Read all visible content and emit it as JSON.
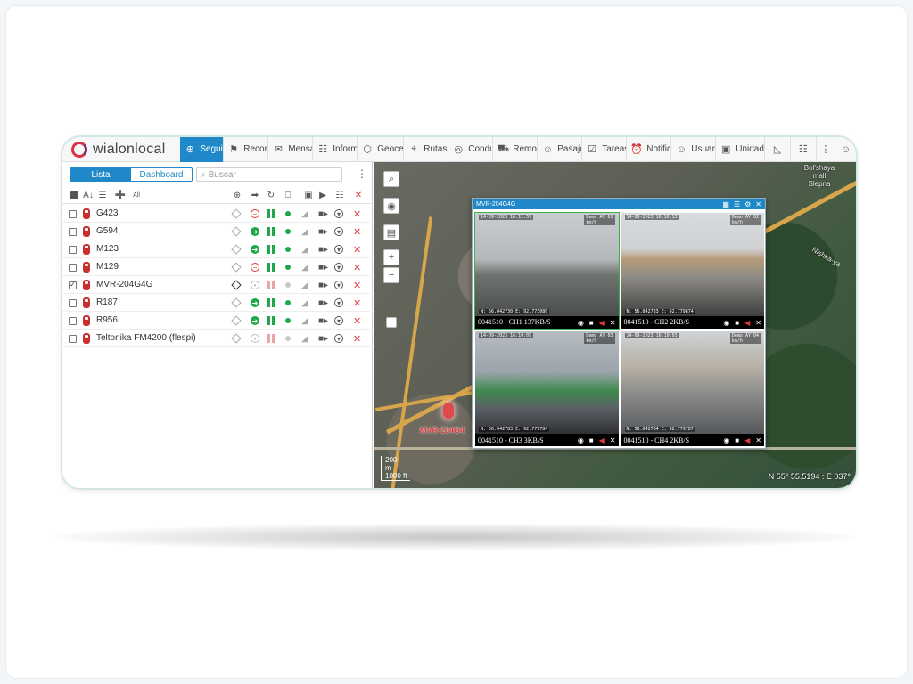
{
  "app": {
    "logo_text": "wialonlocal"
  },
  "tabs": [
    {
      "label": "Seguimiento",
      "icon": "globe-icon"
    },
    {
      "label": "Recorridos",
      "icon": "flag-icon"
    },
    {
      "label": "Mensajes",
      "icon": "message-icon"
    },
    {
      "label": "Informes",
      "icon": "report-icon"
    },
    {
      "label": "Geocercas",
      "icon": "geofence-icon"
    },
    {
      "label": "Rutas",
      "icon": "route-icon"
    },
    {
      "label": "Conductores",
      "icon": "steering-icon"
    },
    {
      "label": "Remolques",
      "icon": "trailer-icon"
    },
    {
      "label": "Pasajeros",
      "icon": "passenger-icon"
    },
    {
      "label": "Tareas",
      "icon": "task-icon"
    },
    {
      "label": "Notificaciones",
      "icon": "alarm-icon"
    },
    {
      "label": "Usuarios",
      "icon": "user-icon"
    },
    {
      "label": "Unidades",
      "icon": "bus-icon"
    }
  ],
  "left_panel": {
    "tab_list": "Lista",
    "tab_dashboard": "Dashboard",
    "search_placeholder": "Buscar",
    "toolbar_all_label": "All",
    "units": [
      {
        "name": "G423",
        "checked": false,
        "move": "stop",
        "bars": "green",
        "dot": "green"
      },
      {
        "name": "G594",
        "checked": false,
        "move": "go",
        "bars": "green",
        "dot": "green"
      },
      {
        "name": "M123",
        "checked": false,
        "move": "go",
        "bars": "green",
        "dot": "green"
      },
      {
        "name": "M129",
        "checked": false,
        "move": "stop",
        "bars": "green",
        "dot": "green"
      },
      {
        "name": "MVR-204G4G",
        "checked": true,
        "move": "none",
        "bars": "red",
        "dot": "gray"
      },
      {
        "name": "R187",
        "checked": false,
        "move": "go",
        "bars": "green",
        "dot": "green"
      },
      {
        "name": "R956",
        "checked": false,
        "move": "go",
        "bars": "green",
        "dot": "green"
      },
      {
        "name": "Teltonika FM4200 (flespi)",
        "checked": false,
        "move": "none",
        "bars": "red",
        "dot": "gray"
      }
    ]
  },
  "map": {
    "unit_label": "MVR-204G4",
    "city_label": "Bol'shaya\nmall\nSlepna",
    "street_label": "Nishka-ya",
    "scale_top": "200\nm",
    "scale_bottom": "1000 ft",
    "coords": "N 55° 55.5194 : E 037°"
  },
  "video": {
    "title": "MVR-204G4G",
    "cams": [
      {
        "label": "0041510 - CH1 137KB/S",
        "date": "14-09-2023 16:11:57",
        "speed": "Demo AY 01\nkm/h",
        "gps": "N: 56.042730 E: 92.773080"
      },
      {
        "label": "0041510 - CH2 2KB/S",
        "date": "14-09-2023 16:10:13",
        "speed": "Demo AY 02\nkm/h",
        "gps": "N: 56.042783 E: 92.779874"
      },
      {
        "label": "0041510 - CH3 3KB/S",
        "date": "14-09-2023 16:10:09",
        "speed": "Demo AY 03\nkm/h",
        "gps": "N: 56.042783 E: 92.779784"
      },
      {
        "label": "0041510 - CH4 2KB/S",
        "date": "14-09-2023 16:10:03",
        "speed": "Demo AY 04\nkm/h",
        "gps": "N: 56.042784 E: 92.779787"
      }
    ]
  },
  "colors": {
    "accent": "#1e88c9",
    "green": "#1fa84a",
    "red": "#e03a3a",
    "brand_red": "#d8334a"
  }
}
